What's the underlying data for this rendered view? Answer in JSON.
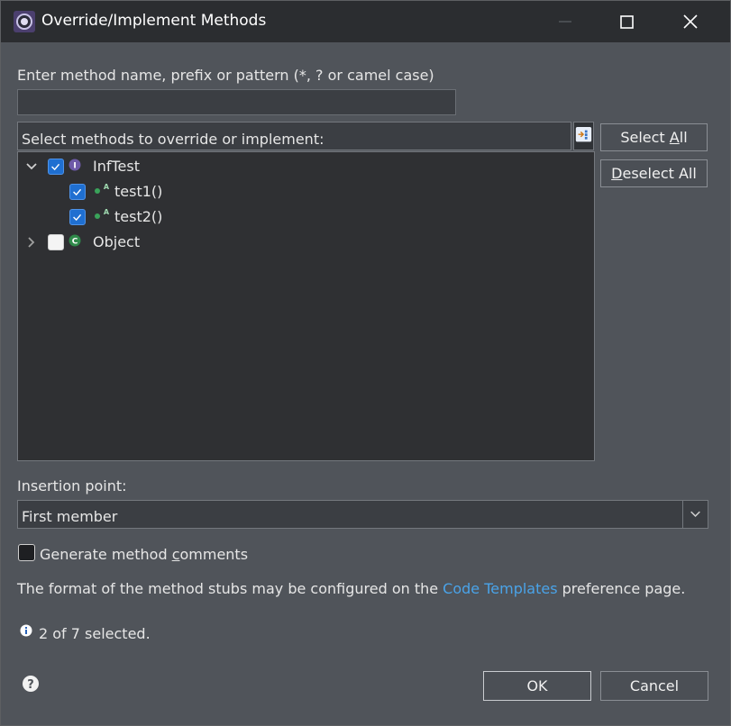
{
  "window": {
    "title": "Override/Implement Methods",
    "controls": [
      "minimize",
      "maximize",
      "close"
    ]
  },
  "filter": {
    "label": "Enter method name, prefix or pattern (*, ? or camel case)",
    "value": ""
  },
  "methods": {
    "header": "Select methods to override or implement:",
    "tree": [
      {
        "label": "InfTest",
        "icon": "interface-icon",
        "expanded": true,
        "checked": true,
        "children": [
          {
            "label": "test1()",
            "icon": "abstract-method-icon",
            "checked": true
          },
          {
            "label": "test2()",
            "icon": "abstract-method-icon",
            "checked": true
          }
        ]
      },
      {
        "label": "Object",
        "icon": "class-icon",
        "expanded": false,
        "checked": false
      }
    ]
  },
  "buttons": {
    "select_all_pre": "Select ",
    "select_all_acc": "A",
    "select_all_post": "ll",
    "deselect_all_pre": "",
    "deselect_all_acc": "D",
    "deselect_all_post": "eselect All",
    "ok": "OK",
    "cancel": "Cancel"
  },
  "insertion": {
    "label": "Insertion point:",
    "selected": "First member"
  },
  "generate_comments": {
    "pre": "Generate method ",
    "acc": "c",
    "post": "omments",
    "checked": false
  },
  "info": {
    "prefix": "The format of the method stubs may be configured on the ",
    "link": "Code Templates",
    "suffix": " preference page."
  },
  "status": {
    "text": "2 of 7 selected."
  },
  "colors": {
    "accent_blue": "#1f6fd1",
    "link": "#4aa3e8",
    "dialog_bg": "#50545a"
  }
}
